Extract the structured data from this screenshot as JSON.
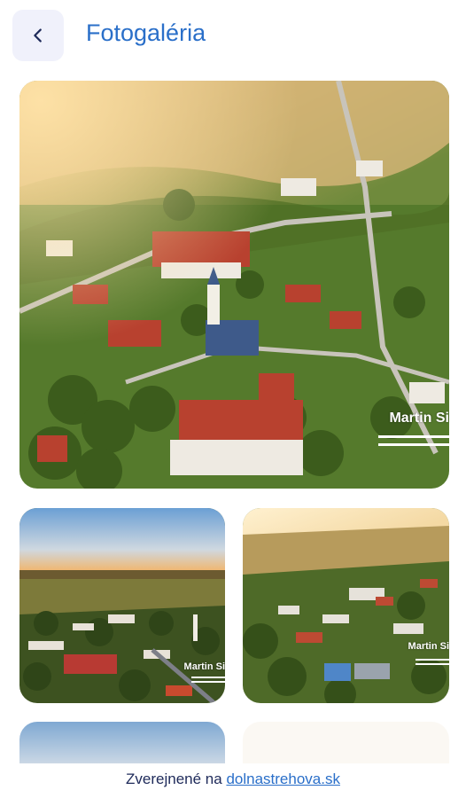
{
  "header": {
    "title": "Fotogaléria",
    "back_icon": "chevron-left-icon"
  },
  "gallery": {
    "watermark": "Martin Si",
    "small_watermark": "Martin Si"
  },
  "footer": {
    "prefix": "Zverejnené na",
    "link": "dolnastrehova.sk"
  },
  "colors": {
    "accent": "#2a6fc9",
    "back_bg": "#f0f1fb",
    "footer_text": "#1e2a5a"
  }
}
